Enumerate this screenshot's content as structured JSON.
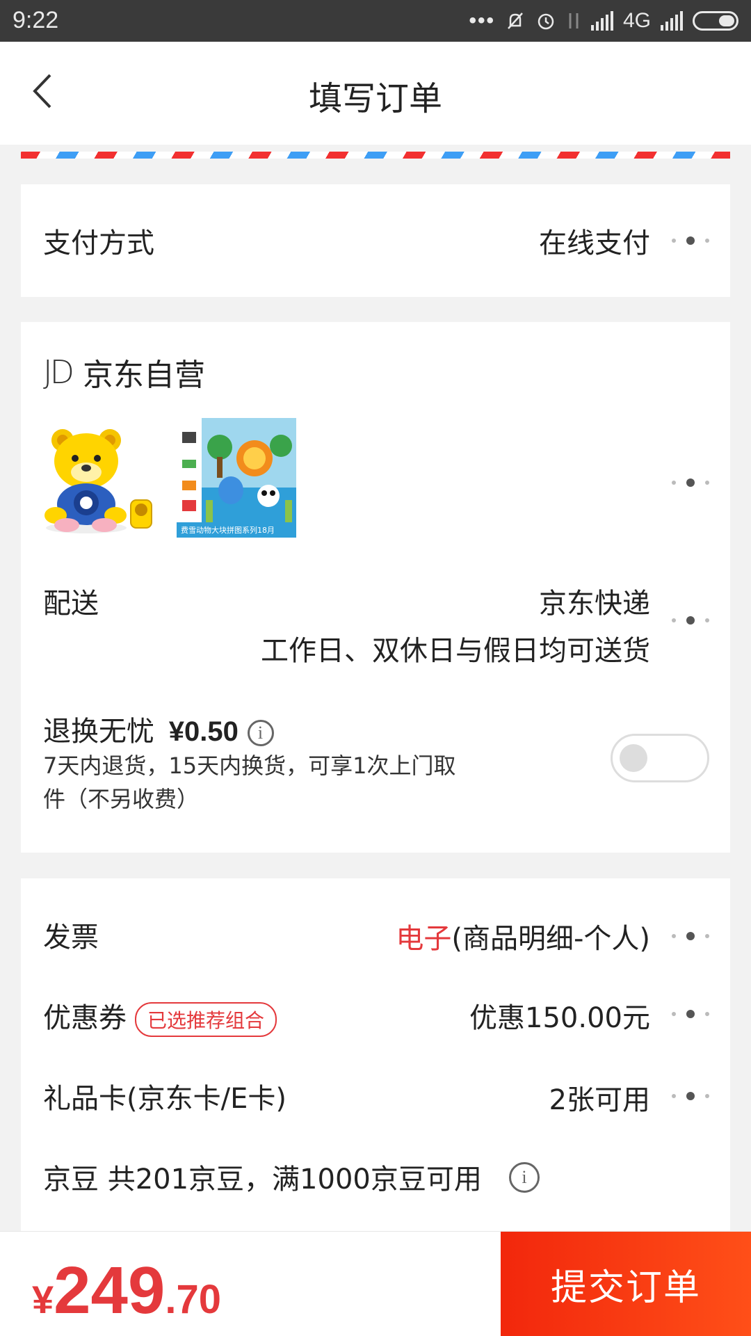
{
  "status_bar": {
    "time": "9:22",
    "network": "4G"
  },
  "header": {
    "title": "填写订单"
  },
  "payment": {
    "label": "支付方式",
    "value": "在线支付"
  },
  "shop": {
    "logo": "JD",
    "name": "京东自营",
    "products": [
      {
        "name": "yellow-bear-toy-image"
      },
      {
        "name": "animal-puzzle-box-image",
        "caption": "费雪动物大块拼图系列18月"
      }
    ]
  },
  "delivery": {
    "label": "配送",
    "carrier": "京东快递",
    "schedule": "工作日、双休日与假日均可送货"
  },
  "return_service": {
    "label": "退换无忧",
    "price": "¥0.50",
    "desc_line1": "7天内退货，15天内换货，可享1次上门取",
    "desc_line2": "件（不另收费）",
    "enabled": false
  },
  "invoice": {
    "label": "发票",
    "type": "电子",
    "detail": "(商品明细-个人)"
  },
  "coupon": {
    "label": "优惠券",
    "tag": "已选推荐组合",
    "value": "优惠150.00元"
  },
  "gift_card": {
    "label": "礼品卡(京东卡/E卡)",
    "value": "2张可用"
  },
  "jingdou": {
    "label": "京豆 共201京豆，满1000京豆可用"
  },
  "footer": {
    "currency": "¥",
    "price_int": "249",
    "price_dec": ".70",
    "submit_label": "提交订单"
  },
  "colors": {
    "accent": "#e4393c",
    "submit": "#f2270c",
    "stripe_red": "#f23030",
    "stripe_blue": "#3e9ef5"
  }
}
